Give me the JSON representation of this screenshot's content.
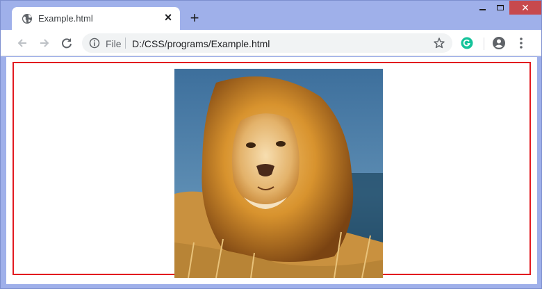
{
  "tab": {
    "title": "Example.html",
    "favicon": "globe-icon",
    "close": "close-icon"
  },
  "new_tab": "plus-icon",
  "window_controls": [
    "minimize-icon",
    "maximize-icon",
    "close-icon"
  ],
  "toolbar": {
    "back": "arrow-left-icon",
    "forward": "arrow-right-icon",
    "reload": "reload-icon",
    "info": "info-icon",
    "scheme_label": "File",
    "url": "D:/CSS/programs/Example.html",
    "bookmark": "star-icon",
    "extension": "grammarly-icon",
    "profile": "account-icon",
    "menu": "kebab-menu-icon"
  },
  "colors": {
    "frame": "#9fb0ea",
    "close_button": "#c7494d",
    "outline": "#e2191f",
    "grammarly": "#15c39a"
  },
  "content": {
    "image": "lion-photo"
  }
}
